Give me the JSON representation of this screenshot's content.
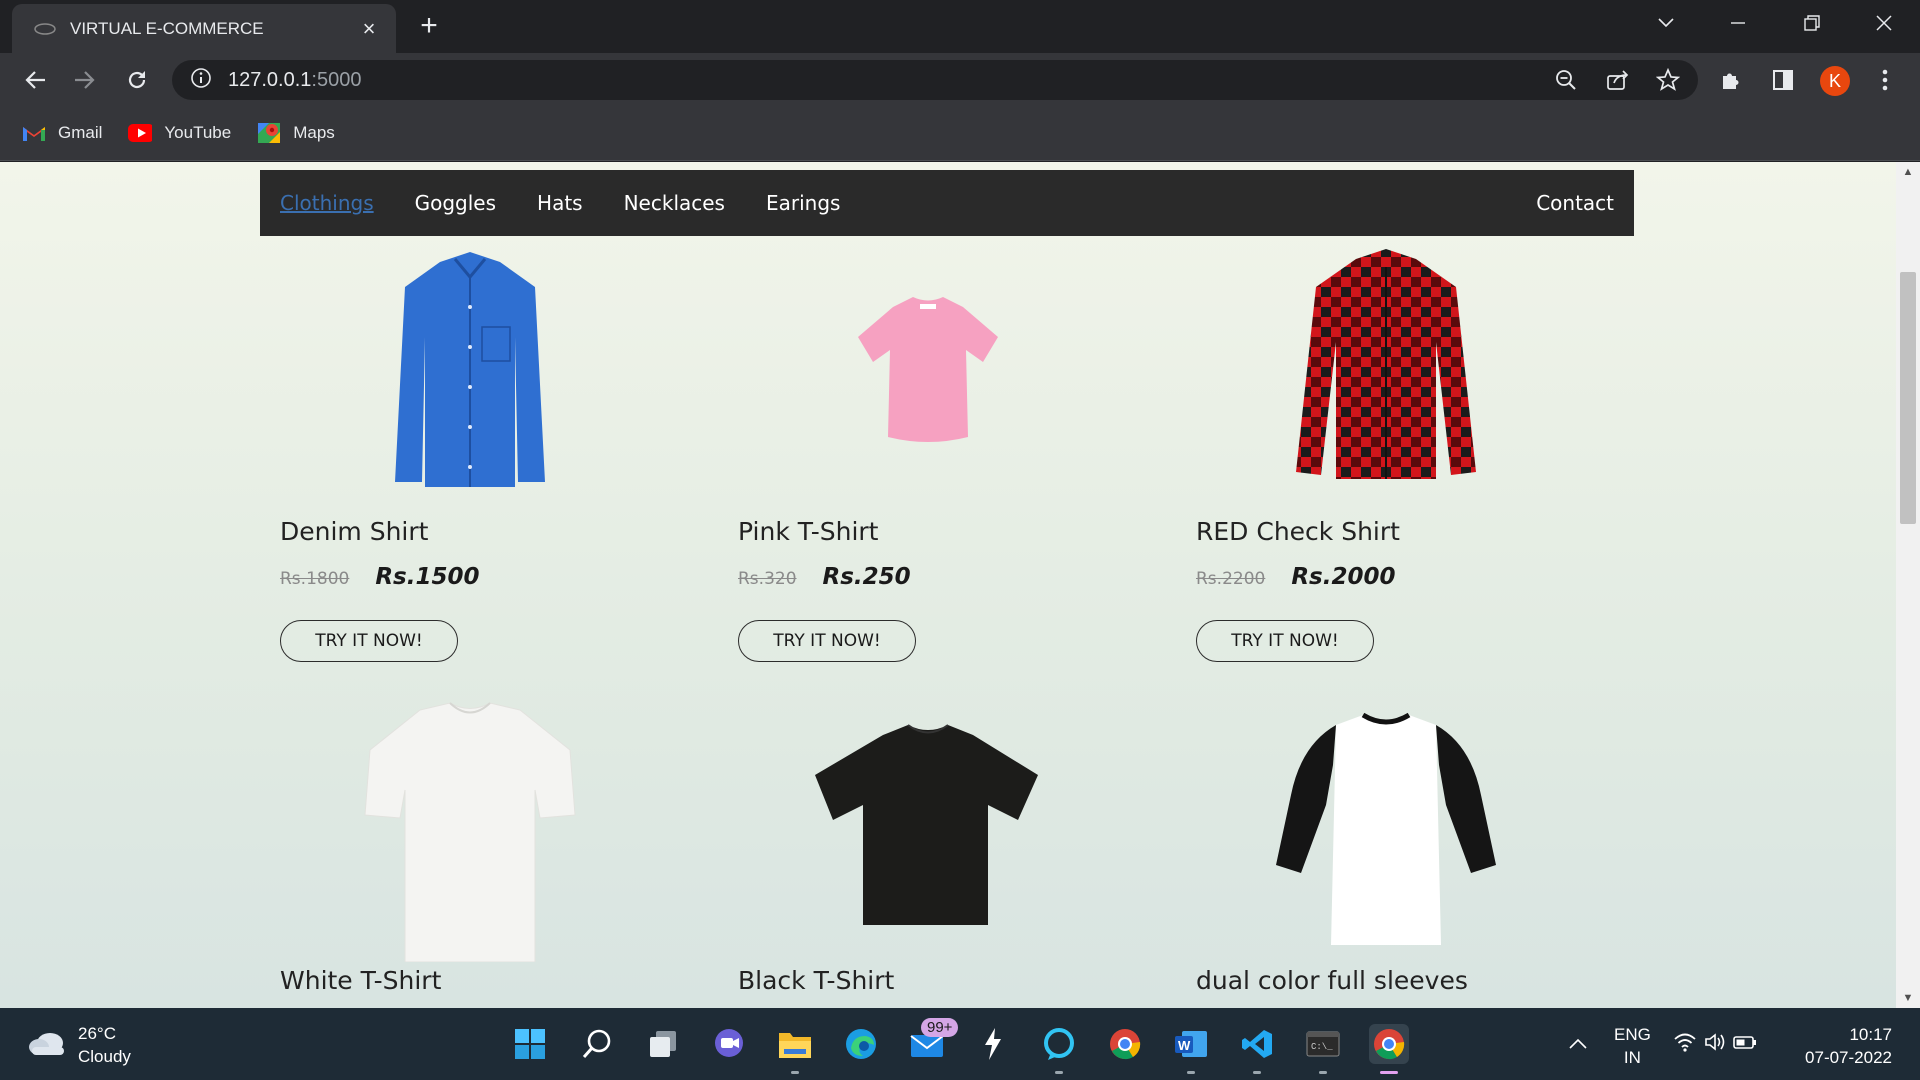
{
  "browser": {
    "tab_title": "VIRTUAL E-COMMERCE",
    "tab_close": "×",
    "new_tab": "+",
    "url_host": "127.0.0.1",
    "url_port": ":5000",
    "profile_initial": "K",
    "bookmarks": [
      {
        "label": "Gmail",
        "icon": "gmail-icon"
      },
      {
        "label": "YouTube",
        "icon": "youtube-icon"
      },
      {
        "label": "Maps",
        "icon": "maps-icon"
      }
    ]
  },
  "site": {
    "nav": [
      "Clothings",
      "Goggles",
      "Hats",
      "Necklaces",
      "Earings"
    ],
    "active_nav": "Clothings",
    "contact": "Contact"
  },
  "products": [
    {
      "name": "Denim Shirt",
      "old_price": "Rs.1800",
      "price": "Rs.1500",
      "button": "TRY IT NOW!",
      "color": "#2f6fd1"
    },
    {
      "name": "Pink T-Shirt",
      "old_price": "Rs.320",
      "price": "Rs.250",
      "button": "TRY IT NOW!",
      "color": "#f6a1c1"
    },
    {
      "name": "RED Check Shirt",
      "old_price": "Rs.2200",
      "price": "Rs.2000",
      "button": "TRY IT NOW!",
      "color": "#d2151b"
    },
    {
      "name": "White T-Shirt",
      "color": "#f4f4f2"
    },
    {
      "name": "Black T-Shirt",
      "color": "#1c1c1a"
    },
    {
      "name": "dual color full sleeves",
      "color": "#ffffff"
    }
  ],
  "taskbar": {
    "temperature": "26°C",
    "condition": "Cloudy",
    "mail_badge": "99+",
    "lang_line1": "ENG",
    "lang_line2": "IN",
    "time": "10:17",
    "date": "07-07-2022"
  }
}
